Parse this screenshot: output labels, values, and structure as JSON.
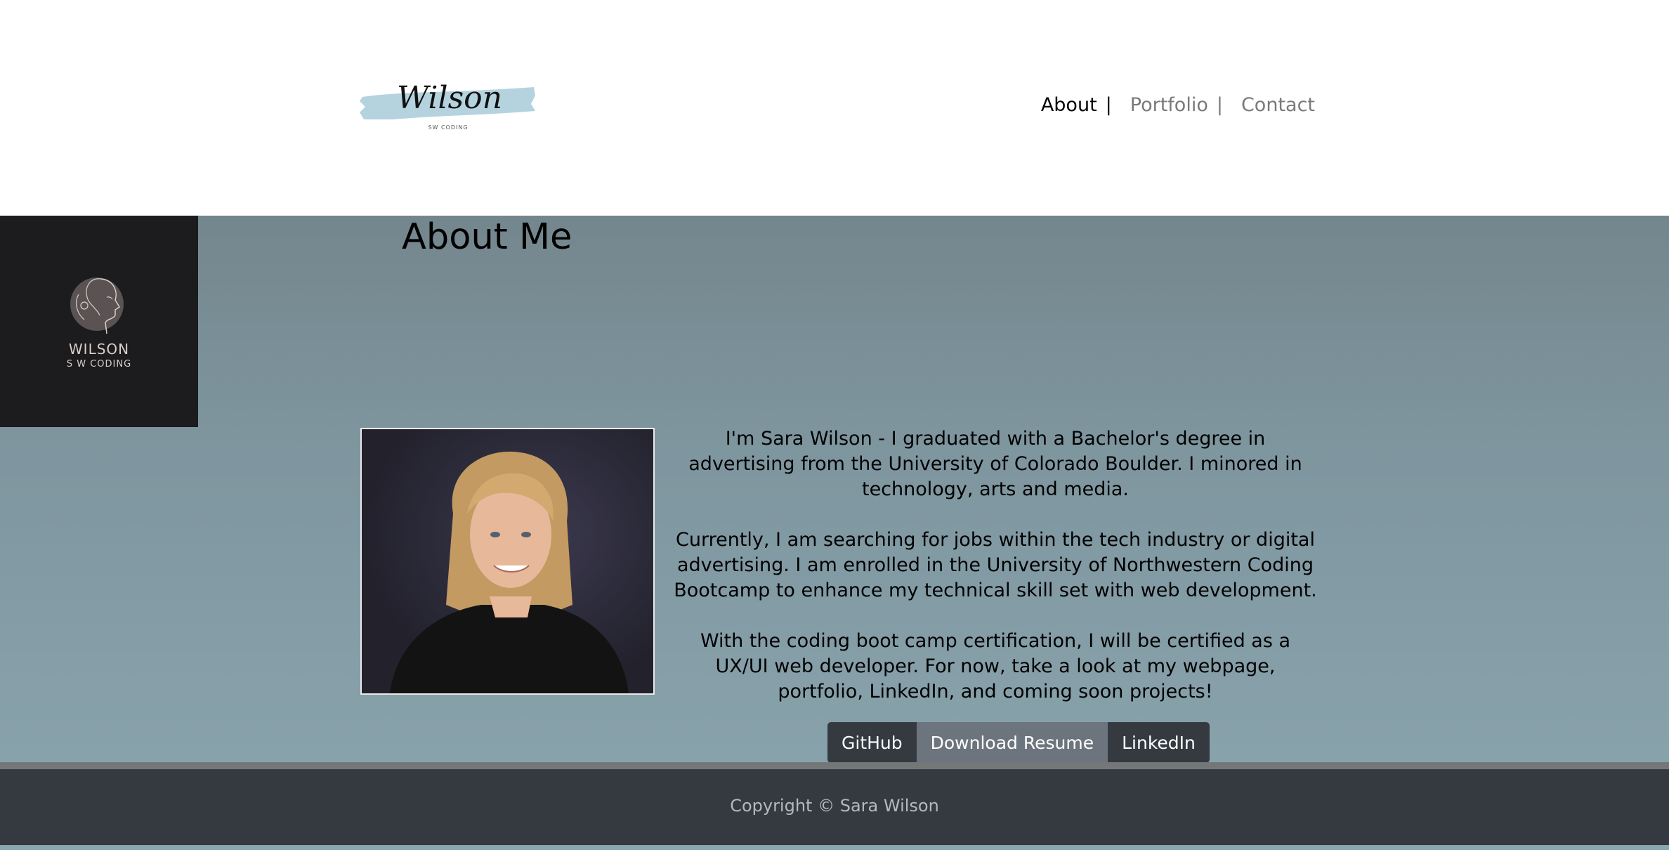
{
  "header": {
    "logo": {
      "wordmark": "Wilson",
      "tagline": "SW CODING",
      "brush_color": "#b4d3df"
    },
    "nav": [
      {
        "label": "About",
        "active": true
      },
      {
        "label": "Portfolio",
        "active": false
      },
      {
        "label": "Contact",
        "active": false
      }
    ],
    "nav_separator": "|"
  },
  "main": {
    "side_badge": {
      "title": "WILSON",
      "subtitle": "S W CODING"
    },
    "page_title": "About Me",
    "bio": [
      "I'm Sara Wilson - I graduated with a Bachelor's degree in advertising from the University of Colorado Boulder. I minored in technology, arts and media.",
      "Currently, I am searching for jobs within the tech industry or digital advertising. I am enrolled in the University of Northwestern Coding Bootcamp to enhance my technical skill set with web development.",
      "With the coding boot camp certification, I will be certified as a UX/UI web developer. For now, take a look at my webpage, portfolio, LinkedIn, and coming soon projects!"
    ],
    "buttons": {
      "github": "GitHub",
      "resume": "Download Resume",
      "linkedin": "LinkedIn"
    }
  },
  "footer": {
    "copyright": "Copyright © Sara Wilson"
  },
  "colors": {
    "main_bg": "#7e959e",
    "footer_bg": "#343a40",
    "button_dark": "#343a40",
    "button_gray": "#6c757d"
  }
}
